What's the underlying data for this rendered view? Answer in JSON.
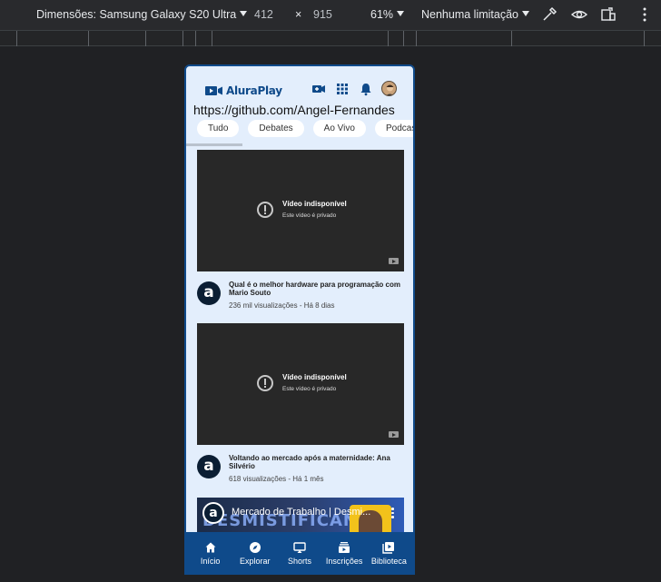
{
  "devtools": {
    "dimensions_label": "Dimensões: Samsung Galaxy S20 Ultra",
    "width": "412",
    "times": "×",
    "height": "915",
    "zoom": "61%",
    "throttle": "Nenhuma limitação"
  },
  "app": {
    "logo_text": "AluraPlay",
    "github_link": "https://github.com/Angel-Fernandes",
    "chips": [
      "Tudo",
      "Debates",
      "Ao Vivo",
      "Podcast"
    ],
    "videos": [
      {
        "unavailable_title": "Vídeo indisponível",
        "unavailable_sub": "Este vídeo é privado",
        "channel_initial": "a",
        "title": "Qual é o melhor hardware para programação com Mario Souto",
        "stats": "236 mil visualizações - Há 8 dias"
      },
      {
        "unavailable_title": "Vídeo indisponível",
        "unavailable_sub": "Este vídeo é privado",
        "channel_initial": "a",
        "title": "Voltando ao mercado após a maternidade: Ana Silvério",
        "stats": "618 visualizações - Há 1 mês"
      }
    ],
    "third_video": {
      "channel_initial": "a",
      "title": "Mercado de Trabalho | Desmi...",
      "thumb_text": "DESMISTIFICANDO"
    },
    "nav": [
      {
        "label": "Início",
        "icon": "home-icon"
      },
      {
        "label": "Explorar",
        "icon": "compass-icon"
      },
      {
        "label": "Shorts",
        "icon": "cast-icon"
      },
      {
        "label": "Inscrições",
        "icon": "subscriptions-icon"
      },
      {
        "label": "Biblioteca",
        "icon": "library-icon"
      }
    ],
    "colors": {
      "brand": "#0f4a8a",
      "background": "#e3eefc"
    }
  }
}
